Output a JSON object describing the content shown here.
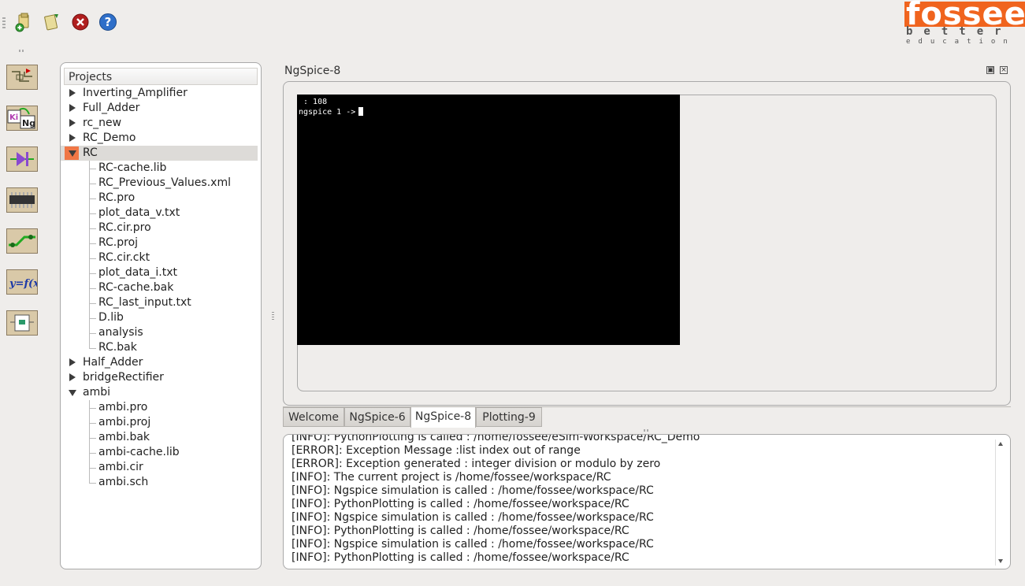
{
  "toolbar": {
    "items": [
      {
        "name": "new-project-icon"
      },
      {
        "name": "open-project-icon"
      },
      {
        "name": "close-project-icon"
      },
      {
        "name": "help-icon"
      }
    ]
  },
  "logo": {
    "main": "fossee",
    "line1": "better",
    "line2": "education",
    "color": "#f0641e"
  },
  "side_tools": [
    {
      "name": "schematic-editor-icon"
    },
    {
      "name": "kicad-to-ngspice-icon"
    },
    {
      "name": "footprint-editor-icon"
    },
    {
      "name": "model-editor-icon"
    },
    {
      "name": "pcb-layout-icon"
    },
    {
      "name": "ngspice-plot-function-icon"
    },
    {
      "name": "subcircuit-icon"
    }
  ],
  "projects": {
    "header": "Projects",
    "tree": [
      {
        "label": "Inverting_Amplifier",
        "expanded": false
      },
      {
        "label": "Full_Adder",
        "expanded": false
      },
      {
        "label": "rc_new",
        "expanded": false
      },
      {
        "label": "RC_Demo",
        "expanded": false
      },
      {
        "label": "RC",
        "expanded": true,
        "selected": true,
        "children": [
          "RC-cache.lib",
          "RC_Previous_Values.xml",
          "RC.pro",
          "plot_data_v.txt",
          "RC.cir.pro",
          "RC.proj",
          "RC.cir.ckt",
          "plot_data_i.txt",
          "RC-cache.bak",
          "RC_last_input.txt",
          "D.lib",
          "analysis",
          "RC.bak"
        ]
      },
      {
        "label": "Half_Adder",
        "expanded": false
      },
      {
        "label": "bridgeRectifier",
        "expanded": false
      },
      {
        "label": "ambi",
        "expanded": true,
        "children": [
          "ambi.pro",
          "ambi.proj",
          "ambi.bak",
          "ambi-cache.lib",
          "ambi.cir",
          "ambi.sch"
        ]
      }
    ]
  },
  "dock": {
    "title": "NgSpice-8",
    "terminal_lines": [
      " : 108",
      "ngspice 1 ->"
    ]
  },
  "tabs": [
    {
      "label": "Welcome"
    },
    {
      "label": "NgSpice-6"
    },
    {
      "label": "NgSpice-8",
      "active": true
    },
    {
      "label": "Plotting-9"
    }
  ],
  "log": {
    "lines": [
      "[INFO]: PythonPlotting is called : /home/fossee/eSim-Workspace/RC_Demo",
      "[ERROR]: Exception Message :list index out of range",
      "[ERROR]: Exception generated : integer division or modulo by zero",
      "[INFO]: The current project is /home/fossee/workspace/RC",
      "[INFO]: Ngspice simulation is called : /home/fossee/workspace/RC",
      "[INFO]: PythonPlotting is called : /home/fossee/workspace/RC",
      "[INFO]: Ngspice simulation is called : /home/fossee/workspace/RC",
      "[INFO]: PythonPlotting is called : /home/fossee/workspace/RC",
      "[INFO]: Ngspice simulation is called : /home/fossee/workspace/RC",
      "[INFO]: PythonPlotting is called : /home/fossee/workspace/RC"
    ]
  }
}
